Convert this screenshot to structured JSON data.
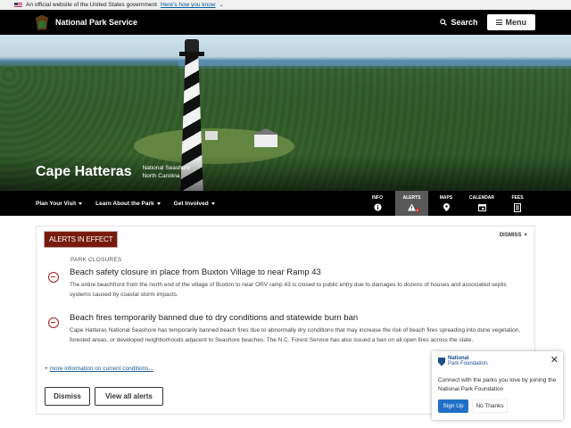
{
  "gov_banner": {
    "text": "An official website of the United States government",
    "link": "Here's how you know"
  },
  "header": {
    "brand": "National Park Service",
    "search_label": "Search",
    "menu_label": "Menu"
  },
  "hero": {
    "park_name": "Cape Hatteras",
    "designation": "National Seashore",
    "state": "North Carolina"
  },
  "subnav": {
    "links": [
      "Plan Your Visit",
      "Learn About the Park",
      "Get Involved"
    ],
    "quick": [
      {
        "label": "INFO",
        "icon": "info-icon"
      },
      {
        "label": "ALERTS",
        "icon": "alert-icon",
        "badge": "2"
      },
      {
        "label": "MAPS",
        "icon": "map-pin-icon"
      },
      {
        "label": "CALENDAR",
        "icon": "calendar-icon"
      },
      {
        "label": "FEES",
        "icon": "fees-icon"
      }
    ]
  },
  "alerts": {
    "tag": "ALERTS IN EFFECT",
    "dismiss_x": "DISMISS",
    "category": "PARK CLOSURES",
    "items": [
      {
        "title": "Beach safety closure in place from Buxton Village to near Ramp 43",
        "body": "The entire beachfront from the north end of the village of Buxton to near ORV ramp 43 is closed to public entry due to damages to dozens of houses and associated septic systems caused by coastal storm impacts."
      },
      {
        "title": "Beach fires temporarily banned due to dry conditions and statewide burn ban",
        "body": "Cape Hatteras National Seashore has temporarily banned beach fires due to abnormally dry conditions that may increase the risk of beach fires spreading into dune vegetation, forested areas, or developed neighborhoods adjacent to Seashore beaches. The N.C. Forest Service has also issued a ban on all open fires across the state."
      }
    ],
    "more_prefix": "+",
    "more_link": "more information on current conditions...",
    "dismiss_button": "Dismiss",
    "view_all_button": "View all alerts"
  },
  "npf_popup": {
    "logo_line1": "National",
    "logo_line2": "Park Foundation.",
    "message": "Connect with the parks you love by joining the National Park Foundation",
    "signup": "Sign Up",
    "no_thanks": "No Thanks"
  }
}
